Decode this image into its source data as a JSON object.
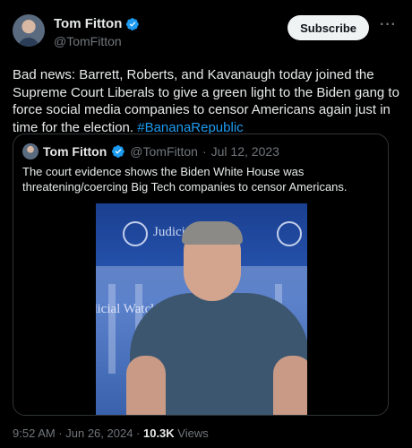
{
  "tweet": {
    "author_name": "Tom Fitton",
    "author_handle": "@TomFitton",
    "subscribe_label": "Subscribe",
    "more_label": "···",
    "text_main": "Bad news: Barrett, Roberts, and Kavanaugh today joined the Supreme Court Liberals to give a green light to the Biden gang to force social media companies to  censor Americans again just in time for the election. ",
    "hashtag": "#BananaRepublic",
    "timestamp": "9:52 AM · Jun 26, 2024 · ",
    "views_count": "10.3K",
    "views_label": " Views"
  },
  "quoted": {
    "author_name": "Tom Fitton",
    "author_handle": "@TomFitton",
    "separator": "·",
    "date": "Jul 12, 2023",
    "text": "The court evidence shows the Biden White House was threatening/coercing Big Tech companies to censor Americans.",
    "media_banner_1": "Judicial Watch",
    "media_banner_2": "dicial Watch"
  },
  "colors": {
    "accent": "#1d9bf0",
    "background": "#000000",
    "muted": "#71767b"
  }
}
